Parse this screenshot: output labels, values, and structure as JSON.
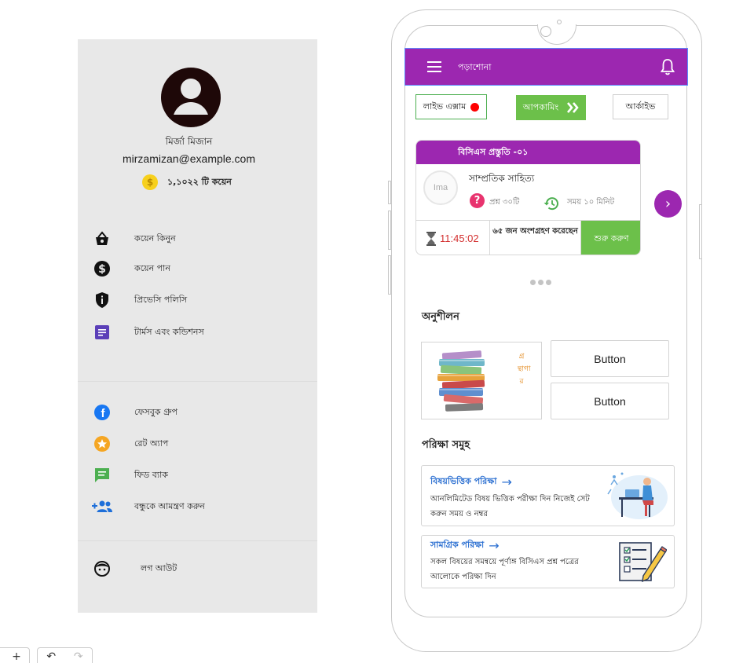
{
  "drawer": {
    "user_name": "মির্জা মিজান",
    "user_email": "mirzamizan@example.com",
    "coin_label": "১,১০২২ টি কয়েন",
    "menu_primary": [
      {
        "label": "কয়েন কিনুন",
        "icon": "basket-icon"
      },
      {
        "label": "কয়েন পান",
        "icon": "dollar-icon"
      },
      {
        "label": "প্রিভেসি পলিসি",
        "icon": "shield-icon"
      },
      {
        "label": "টার্মস এবং কন্ডিশনস",
        "icon": "document-icon"
      }
    ],
    "menu_social": [
      {
        "label": "ফেসবুক গ্রুপ",
        "icon": "facebook-icon"
      },
      {
        "label": "রেট অ্যাপ",
        "icon": "star-icon"
      },
      {
        "label": "ফিড ব্যাক",
        "icon": "feedback-icon"
      },
      {
        "label": "বন্ধুকে আমন্ত্রণ করুন",
        "icon": "add-people-icon"
      }
    ],
    "logout_label": "লগ আউট"
  },
  "app": {
    "title": "পড়াশোনা",
    "tabs": {
      "live": "লাইভ এক্সাম",
      "upcoming": "আপকামিং",
      "archive": "আর্কাইভ"
    },
    "exam": {
      "header": "বিসিএস প্রস্তুতি -০১",
      "image_placeholder": "Ima",
      "subject": "সাম্প্রতিক সাহিত্য",
      "questions": "প্রশ্ন ৩০টি",
      "duration": "সময় ১০ মিনিট",
      "timer": "11:45:02",
      "participants": "৬৫ জন অংশগ্রহণ করেছেন",
      "start": "শুরু করুণ"
    },
    "practice_title": "অনুশীলন",
    "library_label": "গ্রন্থাগার",
    "buttons": [
      "Button",
      "Button"
    ],
    "tests_title": "পরিক্ষা সমুহ",
    "tests": [
      {
        "title": "বিষয়ভিত্তিক পরিক্ষা",
        "desc": "আনলিমিটেড বিষয় ভিত্তিক পরীক্ষা দিন নিজেই সেট করুন সময় ও নম্বর"
      },
      {
        "title": "সামগ্রিক পরিক্ষা",
        "desc": "সকল বিষয়ের সমন্বয়ে পূর্ণাঙ্গ বিসিএস প্রশ্ন পত্রের আলোকে পরিক্ষা দিন"
      }
    ]
  },
  "toolbar": {
    "add": "+",
    "undo": "↶",
    "redo": "↷"
  }
}
